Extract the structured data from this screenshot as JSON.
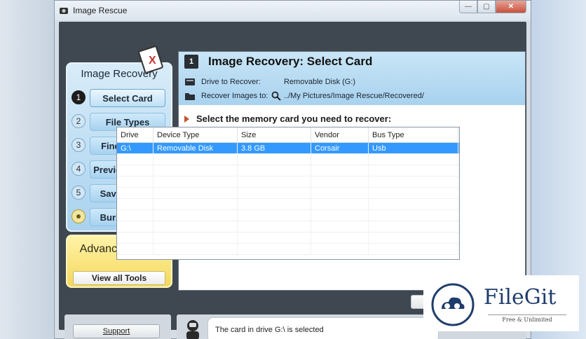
{
  "window": {
    "title": "Image Rescue",
    "controls": {
      "minimize": "—",
      "maximize": "▢",
      "close": "✕"
    }
  },
  "nav": {
    "header": "Image Recovery",
    "items": [
      {
        "num": "1",
        "label": "Select Card",
        "active": true
      },
      {
        "num": "2",
        "label": "File Types"
      },
      {
        "num": "3",
        "label": "Find Images"
      },
      {
        "num": "4",
        "label": "Preview Images"
      },
      {
        "num": "5",
        "label": "Save Images"
      },
      {
        "num": "",
        "label": "Burn Images"
      }
    ]
  },
  "advanced": {
    "title": "Advanced Tools",
    "button": "View all Tools"
  },
  "support": {
    "label": "Support"
  },
  "main": {
    "step": "1",
    "title": "Image Recovery: Select Card",
    "drive_label": "Drive to Recover:",
    "drive_value": "Removable Disk (G:)",
    "recover_label": "Recover Images to:",
    "recover_value": "../My Pictures/Image Rescue/Recovered/",
    "prompt": "Select the memory card you need to recover:"
  },
  "table": {
    "headers": [
      "Drive",
      "Device Type",
      "Size",
      "Vendor",
      "Bus Type"
    ],
    "rows": [
      [
        "G:\\",
        "Removable Disk",
        "3.8 GB",
        "Corsair",
        "Usb"
      ]
    ]
  },
  "buttons": {
    "go": "G"
  },
  "status": {
    "text": "The card in drive G:\\ is selected"
  },
  "watermark": {
    "name": "FileGit",
    "tagline": "Free & Unlimited"
  },
  "colors": {
    "accent": "#3399ff",
    "nav_bg": "#a9d2ef",
    "adv_bg": "#f4d85c"
  }
}
